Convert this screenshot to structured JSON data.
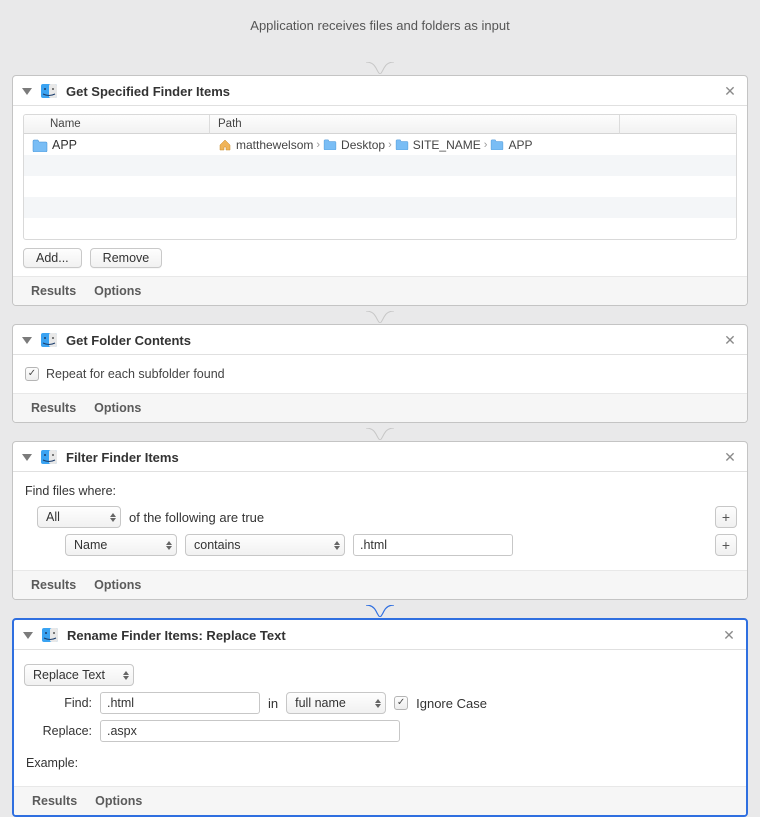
{
  "header": {
    "input_description": "Application receives files and folders as input"
  },
  "a1": {
    "title": "Get Specified Finder Items",
    "cols": {
      "name": "Name",
      "path": "Path"
    },
    "item": {
      "name": "APP"
    },
    "breadcrumb": [
      "matthewelsom",
      "Desktop",
      "SITE_NAME",
      "APP"
    ],
    "buttons": {
      "add": "Add...",
      "remove": "Remove"
    },
    "footer": {
      "results": "Results",
      "options": "Options"
    }
  },
  "a2": {
    "title": "Get Folder Contents",
    "repeat_label": "Repeat for each subfolder found",
    "repeat_checked": true,
    "footer": {
      "results": "Results",
      "options": "Options"
    }
  },
  "a3": {
    "title": "Filter Finder Items",
    "find_label": "Find files where:",
    "combinator": "All",
    "combinator_suffix": "of the following are true",
    "rule": {
      "field": "Name",
      "op": "contains",
      "value": ".html"
    },
    "footer": {
      "results": "Results",
      "options": "Options"
    }
  },
  "a4": {
    "title": "Rename Finder Items: Replace Text",
    "mode": "Replace Text",
    "find_label": "Find:",
    "find_value": ".html",
    "in_label": "in",
    "in_value": "full name",
    "ignore_case_label": "Ignore Case",
    "ignore_case_checked": true,
    "replace_label": "Replace:",
    "replace_value": ".aspx",
    "example_label": "Example:",
    "footer": {
      "results": "Results",
      "options": "Options"
    }
  }
}
